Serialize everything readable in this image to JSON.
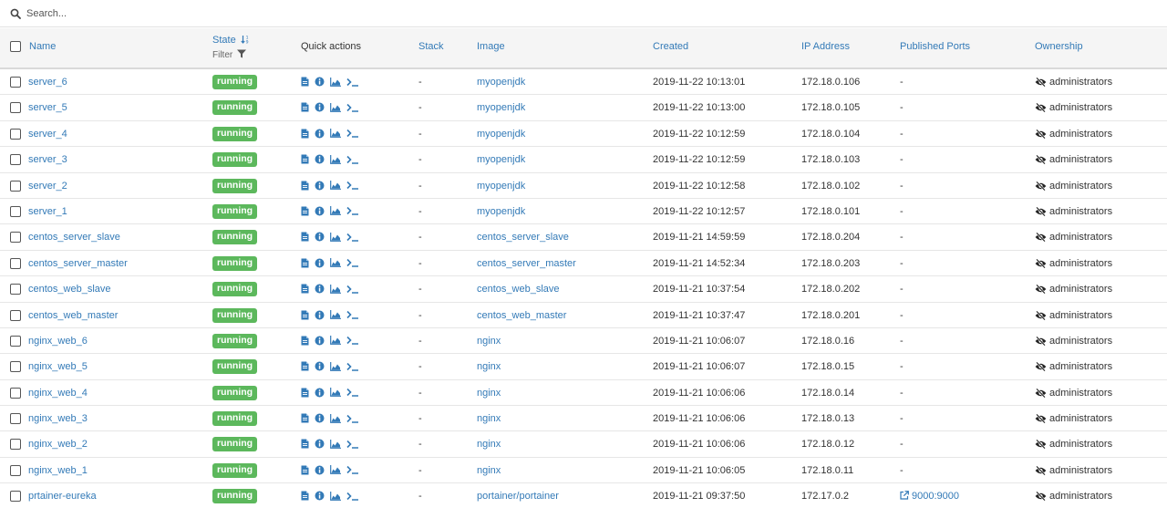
{
  "search": {
    "placeholder": "Search..."
  },
  "table": {
    "headers": {
      "name": "Name",
      "state": "State",
      "filter": "Filter",
      "quick_actions": "Quick actions",
      "stack": "Stack",
      "image": "Image",
      "created": "Created",
      "ip": "IP Address",
      "ports": "Published Ports",
      "ownership": "Ownership"
    },
    "rows": [
      {
        "name": "server_6",
        "state": "running",
        "stack": "-",
        "image": "myopenjdk",
        "created": "2019-11-22 10:13:01",
        "ip": "172.18.0.106",
        "ports": "-",
        "ownership": "administrators"
      },
      {
        "name": "server_5",
        "state": "running",
        "stack": "-",
        "image": "myopenjdk",
        "created": "2019-11-22 10:13:00",
        "ip": "172.18.0.105",
        "ports": "-",
        "ownership": "administrators"
      },
      {
        "name": "server_4",
        "state": "running",
        "stack": "-",
        "image": "myopenjdk",
        "created": "2019-11-22 10:12:59",
        "ip": "172.18.0.104",
        "ports": "-",
        "ownership": "administrators"
      },
      {
        "name": "server_3",
        "state": "running",
        "stack": "-",
        "image": "myopenjdk",
        "created": "2019-11-22 10:12:59",
        "ip": "172.18.0.103",
        "ports": "-",
        "ownership": "administrators"
      },
      {
        "name": "server_2",
        "state": "running",
        "stack": "-",
        "image": "myopenjdk",
        "created": "2019-11-22 10:12:58",
        "ip": "172.18.0.102",
        "ports": "-",
        "ownership": "administrators"
      },
      {
        "name": "server_1",
        "state": "running",
        "stack": "-",
        "image": "myopenjdk",
        "created": "2019-11-22 10:12:57",
        "ip": "172.18.0.101",
        "ports": "-",
        "ownership": "administrators"
      },
      {
        "name": "centos_server_slave",
        "state": "running",
        "stack": "-",
        "image": "centos_server_slave",
        "created": "2019-11-21 14:59:59",
        "ip": "172.18.0.204",
        "ports": "-",
        "ownership": "administrators"
      },
      {
        "name": "centos_server_master",
        "state": "running",
        "stack": "-",
        "image": "centos_server_master",
        "created": "2019-11-21 14:52:34",
        "ip": "172.18.0.203",
        "ports": "-",
        "ownership": "administrators"
      },
      {
        "name": "centos_web_slave",
        "state": "running",
        "stack": "-",
        "image": "centos_web_slave",
        "created": "2019-11-21 10:37:54",
        "ip": "172.18.0.202",
        "ports": "-",
        "ownership": "administrators"
      },
      {
        "name": "centos_web_master",
        "state": "running",
        "stack": "-",
        "image": "centos_web_master",
        "created": "2019-11-21 10:37:47",
        "ip": "172.18.0.201",
        "ports": "-",
        "ownership": "administrators"
      },
      {
        "name": "nginx_web_6",
        "state": "running",
        "stack": "-",
        "image": "nginx",
        "created": "2019-11-21 10:06:07",
        "ip": "172.18.0.16",
        "ports": "-",
        "ownership": "administrators"
      },
      {
        "name": "nginx_web_5",
        "state": "running",
        "stack": "-",
        "image": "nginx",
        "created": "2019-11-21 10:06:07",
        "ip": "172.18.0.15",
        "ports": "-",
        "ownership": "administrators"
      },
      {
        "name": "nginx_web_4",
        "state": "running",
        "stack": "-",
        "image": "nginx",
        "created": "2019-11-21 10:06:06",
        "ip": "172.18.0.14",
        "ports": "-",
        "ownership": "administrators"
      },
      {
        "name": "nginx_web_3",
        "state": "running",
        "stack": "-",
        "image": "nginx",
        "created": "2019-11-21 10:06:06",
        "ip": "172.18.0.13",
        "ports": "-",
        "ownership": "administrators"
      },
      {
        "name": "nginx_web_2",
        "state": "running",
        "stack": "-",
        "image": "nginx",
        "created": "2019-11-21 10:06:06",
        "ip": "172.18.0.12",
        "ports": "-",
        "ownership": "administrators"
      },
      {
        "name": "nginx_web_1",
        "state": "running",
        "stack": "-",
        "image": "nginx",
        "created": "2019-11-21 10:06:05",
        "ip": "172.18.0.11",
        "ports": "-",
        "ownership": "administrators"
      },
      {
        "name": "prtainer-eureka",
        "state": "running",
        "stack": "-",
        "image": "portainer/portainer",
        "created": "2019-11-21 09:37:50",
        "ip": "172.17.0.2",
        "ports": "9000:9000",
        "ports_is_link": true,
        "ownership": "administrators"
      }
    ]
  },
  "icons": {
    "search": "search-icon",
    "sort": "sort-numeric-icon",
    "filter": "filter-icon",
    "logs": "file-icon",
    "inspect": "info-circle-icon",
    "stats": "area-chart-icon",
    "console": "terminal-icon",
    "ownership": "eye-slash-icon",
    "port_link": "external-link-icon"
  },
  "colors": {
    "link": "#337ab7",
    "running_badge": "#5cb85c"
  }
}
